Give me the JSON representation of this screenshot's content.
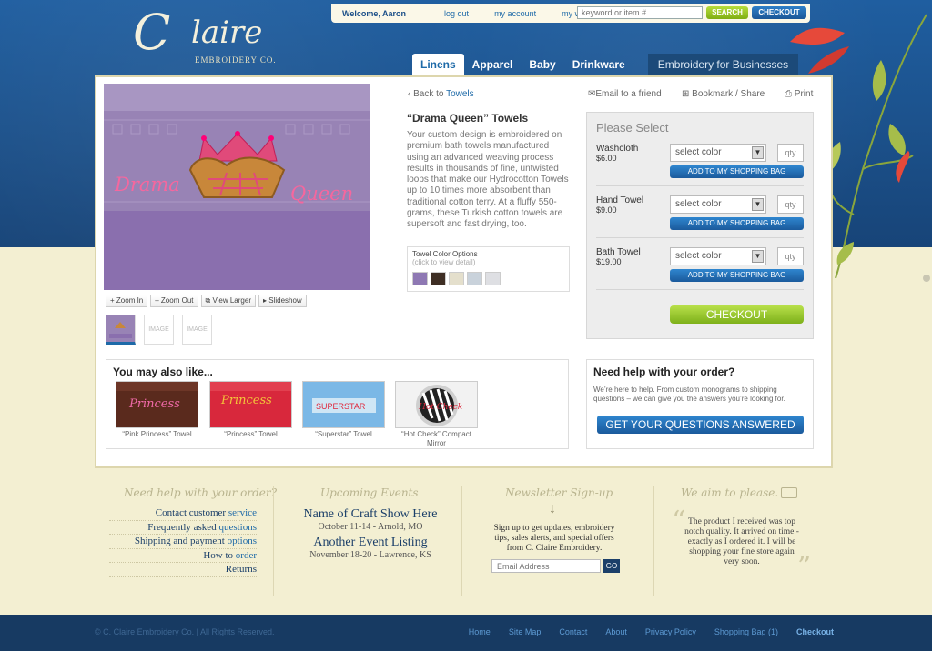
{
  "logo": {
    "big": "C",
    "rest": "laire",
    "sub": "EMBROIDERY CO."
  },
  "topbar": {
    "welcome": "Welcome, Aaron",
    "logout": "log out",
    "account": "my account",
    "wishlist": "my wishlist",
    "search_placeholder": "keyword or item #",
    "search_btn": "SEARCH",
    "checkout": "CHECKOUT"
  },
  "nav": {
    "tabs": [
      "Linens",
      "Apparel",
      "Baby",
      "Drinkware"
    ],
    "business": "Embroidery for Businesses"
  },
  "product": {
    "back_prefix": "Back to",
    "back_link": "Towels",
    "email": "Email to a friend",
    "bookmark": "Bookmark / Share",
    "print": "Print",
    "title": "“Drama Queen” Towels",
    "description": "Your custom design is embroidered on premium bath towels manufactured using an advanced weaving process results in thousands of fine, untwisted loops that make our Hydrocotton Towels up to 10 times more absorbent than traditional cotton terry. At a fluffy 550-grams, these Turkish cotton towels are supersoft and fast drying, too.",
    "image_text_left": "Drama",
    "image_text_right": "Queen",
    "color_options_title": "Towel Color Options",
    "color_options_hint": "(click to view detail)",
    "swatch_colors": [
      "#8e78b3",
      "#3e2e24",
      "#e4dfcc",
      "#c9d2db",
      "#dedfe3"
    ]
  },
  "viewer": {
    "zoom_in": "Zoom In",
    "zoom_out": "Zoom Out",
    "view_larger": "View Larger",
    "slideshow": "Slideshow",
    "thumb_placeholder": "IMAGE"
  },
  "select_panel": {
    "title": "Please Select",
    "items": [
      {
        "name": "Washcloth",
        "price": "$6.00",
        "select": "select color",
        "qty": "qty",
        "add": "ADD TO MY SHOPPING BAG"
      },
      {
        "name": "Hand Towel",
        "price": "$9.00",
        "select": "select color",
        "qty": "qty",
        "add": "ADD TO MY SHOPPING BAG"
      },
      {
        "name": "Bath Towel",
        "price": "$19.00",
        "select": "select color",
        "qty": "qty",
        "add": "ADD TO MY SHOPPING BAG"
      }
    ],
    "checkout": "CHECKOUT"
  },
  "also_like": {
    "title": "You may also like...",
    "items": [
      {
        "caption": "“Pink Princess” Towel",
        "img_text": "Princess",
        "bg": "#5a2a1d",
        "fg": "#f06aa8"
      },
      {
        "caption": "“Princess” Towel",
        "img_text": "Princess",
        "bg": "#d8283c",
        "fg": "#f3c43a"
      },
      {
        "caption": "“Superstar” Towel",
        "img_text": "SUPERSTAR",
        "bg": "#7bb8e6",
        "fg": "#e0283c"
      },
      {
        "caption": "“Hot Check” Compact Mirror",
        "img_text": "Hot Check",
        "bg": "#cfcfcf",
        "fg": "#d8283c"
      }
    ]
  },
  "help": {
    "title": "Need help with your order?",
    "text": "We’re here to help.  From custom monograms to shipping questions – we can give you the answers you’re looking for.",
    "button": "GET YOUR QUESTIONS ANSWERED"
  },
  "footer": {
    "help_heading": "Need help with your order?",
    "help_links": [
      {
        "dark": "Contact customer",
        "blue": "service"
      },
      {
        "dark": "Frequently asked",
        "blue": "questions"
      },
      {
        "dark": "Shipping and payment",
        "blue": "options"
      },
      {
        "dark": "How to",
        "blue": "order"
      },
      {
        "dark": "Returns",
        "blue": ""
      }
    ],
    "events_heading": "Upcoming Events",
    "events": [
      {
        "title": "Name of Craft Show Here",
        "sub": "October 11-14 - Arnold, MO"
      },
      {
        "title": "Another Event Listing",
        "sub": "November 18-20 - Lawrence, KS"
      }
    ],
    "newsletter_heading": "Newsletter Sign-up",
    "newsletter_text": "Sign up to get updates, embroidery tips, sales alerts, and special offers from  C. Claire Embroidery.",
    "newsletter_placeholder": "Email Address",
    "newsletter_go": "GO",
    "aim_heading": "We aim to please.",
    "testimonial": "The product I received was top notch quality. It arrived on time - exactly as I ordered it. I will be shopping your fine store again very soon."
  },
  "bottom": {
    "copyright": "© C. Claire Embroidery Co. | All Rights Reserved.",
    "links": [
      "Home",
      "Site Map",
      "Contact",
      "About",
      "Privacy Policy",
      "Shopping Bag (1)"
    ],
    "checkout": "Checkout"
  }
}
